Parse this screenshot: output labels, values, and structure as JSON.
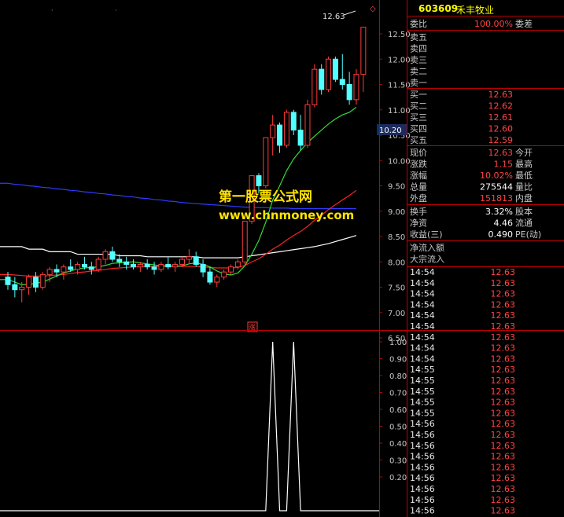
{
  "stock": {
    "code": "603609",
    "name": "禾丰牧业"
  },
  "watermark": {
    "line1": "第一股票公式网",
    "line2": "www.chnmoney.com"
  },
  "price_marker_top": "12.63",
  "price_marker_right": "10.20",
  "indicator_label": "涨",
  "quote": {
    "weibi_label": "委比",
    "weibi_value": "100.00%",
    "weicha_label": "委差",
    "sell_labels": [
      "卖五",
      "卖四",
      "卖三",
      "卖二",
      "卖一"
    ],
    "buy": [
      {
        "label": "买一",
        "price": "12.63"
      },
      {
        "label": "买二",
        "price": "12.62"
      },
      {
        "label": "买三",
        "price": "12.61"
      },
      {
        "label": "买四",
        "price": "12.60"
      },
      {
        "label": "买五",
        "price": "12.59"
      }
    ],
    "stats": [
      {
        "l1": "现价",
        "v1": "12.63",
        "l2": "今开",
        "c": "#ff4444"
      },
      {
        "l1": "涨跌",
        "v1": "1.15",
        "l2": "最高",
        "c": "#ff4444"
      },
      {
        "l1": "涨幅",
        "v1": "10.02%",
        "l2": "最低",
        "c": "#ff4444"
      },
      {
        "l1": "总量",
        "v1": "275544",
        "l2": "量比",
        "c": "#ffffff"
      },
      {
        "l1": "外盘",
        "v1": "151813",
        "l2": "内盘",
        "c": "#ff4444"
      }
    ],
    "stats2": [
      {
        "l1": "换手",
        "v1": "3.32%",
        "l2": "股本"
      },
      {
        "l1": "净资",
        "v1": "4.46",
        "l2": "流通"
      },
      {
        "l1": "收益(三)",
        "v1": "0.490",
        "l2": "PE(动)"
      }
    ],
    "flow_labels": [
      "净流入额",
      "大宗流入"
    ]
  },
  "ticks": [
    {
      "t": "14:54",
      "p": "12.63"
    },
    {
      "t": "14:54",
      "p": "12.63"
    },
    {
      "t": "14:54",
      "p": "12.63"
    },
    {
      "t": "14:54",
      "p": "12.63"
    },
    {
      "t": "14:54",
      "p": "12.63"
    },
    {
      "t": "14:54",
      "p": "12.63"
    },
    {
      "t": "14:54",
      "p": "12.63"
    },
    {
      "t": "14:54",
      "p": "12.63"
    },
    {
      "t": "14:54",
      "p": "12.63"
    },
    {
      "t": "14:55",
      "p": "12.63"
    },
    {
      "t": "14:55",
      "p": "12.63"
    },
    {
      "t": "14:55",
      "p": "12.63"
    },
    {
      "t": "14:55",
      "p": "12.63"
    },
    {
      "t": "14:55",
      "p": "12.63"
    },
    {
      "t": "14:56",
      "p": "12.63"
    },
    {
      "t": "14:56",
      "p": "12.63"
    },
    {
      "t": "14:56",
      "p": "12.63"
    },
    {
      "t": "14:56",
      "p": "12.63"
    },
    {
      "t": "14:56",
      "p": "12.63"
    },
    {
      "t": "14:56",
      "p": "12.63"
    },
    {
      "t": "14:56",
      "p": "12.63"
    },
    {
      "t": "14:56",
      "p": "12.63"
    },
    {
      "t": "14:56",
      "p": "12.63"
    }
  ],
  "chart_data": [
    {
      "type": "candlestick",
      "title": "",
      "ylim": [
        6.4,
        12.6
      ],
      "yticks": [
        "12.50",
        "12.00",
        "11.50",
        "11.00",
        "10.50",
        "10.00",
        "9.50",
        "9.00",
        "8.50",
        "8.00",
        "7.50",
        "7.00",
        "6.50"
      ],
      "candles": [
        {
          "o": 7.7,
          "h": 7.8,
          "l": 7.45,
          "c": 7.55
        },
        {
          "o": 7.55,
          "h": 7.7,
          "l": 7.3,
          "c": 7.45
        },
        {
          "o": 7.45,
          "h": 7.6,
          "l": 7.2,
          "c": 7.5
        },
        {
          "o": 7.5,
          "h": 7.75,
          "l": 7.35,
          "c": 7.7
        },
        {
          "o": 7.7,
          "h": 7.8,
          "l": 7.4,
          "c": 7.5
        },
        {
          "o": 7.5,
          "h": 7.8,
          "l": 7.45,
          "c": 7.75
        },
        {
          "o": 7.75,
          "h": 7.9,
          "l": 7.6,
          "c": 7.85
        },
        {
          "o": 7.85,
          "h": 7.95,
          "l": 7.7,
          "c": 7.8
        },
        {
          "o": 7.8,
          "h": 7.95,
          "l": 7.65,
          "c": 7.9
        },
        {
          "o": 7.9,
          "h": 8.05,
          "l": 7.8,
          "c": 7.85
        },
        {
          "o": 7.85,
          "h": 8.0,
          "l": 7.75,
          "c": 7.95
        },
        {
          "o": 7.95,
          "h": 8.1,
          "l": 7.85,
          "c": 7.9
        },
        {
          "o": 7.9,
          "h": 8.0,
          "l": 7.75,
          "c": 7.85
        },
        {
          "o": 7.85,
          "h": 8.1,
          "l": 7.8,
          "c": 8.05
        },
        {
          "o": 8.05,
          "h": 8.25,
          "l": 7.95,
          "c": 8.2
        },
        {
          "o": 8.2,
          "h": 8.3,
          "l": 8.0,
          "c": 8.05
        },
        {
          "o": 8.05,
          "h": 8.15,
          "l": 7.9,
          "c": 8.0
        },
        {
          "o": 8.0,
          "h": 8.1,
          "l": 7.85,
          "c": 7.95
        },
        {
          "o": 7.95,
          "h": 8.05,
          "l": 7.85,
          "c": 7.9
        },
        {
          "o": 7.9,
          "h": 8.0,
          "l": 7.8,
          "c": 7.95
        },
        {
          "o": 7.95,
          "h": 8.05,
          "l": 7.85,
          "c": 7.9
        },
        {
          "o": 7.9,
          "h": 8.0,
          "l": 7.75,
          "c": 7.85
        },
        {
          "o": 7.85,
          "h": 8.0,
          "l": 7.8,
          "c": 7.95
        },
        {
          "o": 7.95,
          "h": 8.1,
          "l": 7.85,
          "c": 7.9
        },
        {
          "o": 7.9,
          "h": 8.0,
          "l": 7.8,
          "c": 7.95
        },
        {
          "o": 7.95,
          "h": 8.1,
          "l": 7.9,
          "c": 8.05
        },
        {
          "o": 8.05,
          "h": 8.25,
          "l": 7.95,
          "c": 8.1
        },
        {
          "o": 8.1,
          "h": 8.2,
          "l": 7.9,
          "c": 7.95
        },
        {
          "o": 7.95,
          "h": 8.05,
          "l": 7.7,
          "c": 7.8
        },
        {
          "o": 7.8,
          "h": 7.9,
          "l": 7.55,
          "c": 7.6
        },
        {
          "o": 7.6,
          "h": 7.75,
          "l": 7.5,
          "c": 7.7
        },
        {
          "o": 7.7,
          "h": 7.85,
          "l": 7.65,
          "c": 7.8
        },
        {
          "o": 7.8,
          "h": 7.95,
          "l": 7.75,
          "c": 7.9
        },
        {
          "o": 7.9,
          "h": 8.05,
          "l": 7.85,
          "c": 8.0
        },
        {
          "o": 8.0,
          "h": 8.8,
          "l": 7.95,
          "c": 8.8
        },
        {
          "o": 8.8,
          "h": 9.7,
          "l": 8.75,
          "c": 9.7
        },
        {
          "o": 9.7,
          "h": 9.75,
          "l": 9.35,
          "c": 9.5
        },
        {
          "o": 9.5,
          "h": 10.45,
          "l": 9.45,
          "c": 10.45
        },
        {
          "o": 10.45,
          "h": 10.9,
          "l": 10.1,
          "c": 10.7
        },
        {
          "o": 10.7,
          "h": 10.75,
          "l": 10.15,
          "c": 10.3
        },
        {
          "o": 10.3,
          "h": 11.0,
          "l": 10.25,
          "c": 10.95
        },
        {
          "o": 10.95,
          "h": 11.0,
          "l": 10.5,
          "c": 10.6
        },
        {
          "o": 10.6,
          "h": 10.9,
          "l": 10.2,
          "c": 10.3
        },
        {
          "o": 10.3,
          "h": 11.2,
          "l": 10.25,
          "c": 11.1
        },
        {
          "o": 11.1,
          "h": 11.9,
          "l": 11.05,
          "c": 11.8
        },
        {
          "o": 11.8,
          "h": 11.9,
          "l": 11.3,
          "c": 11.4
        },
        {
          "o": 11.4,
          "h": 12.05,
          "l": 11.35,
          "c": 12.0
        },
        {
          "o": 12.0,
          "h": 12.05,
          "l": 11.55,
          "c": 11.6
        },
        {
          "o": 11.6,
          "h": 12.1,
          "l": 11.4,
          "c": 11.5
        },
        {
          "o": 11.5,
          "h": 11.75,
          "l": 11.1,
          "c": 11.2
        },
        {
          "o": 11.2,
          "h": 11.8,
          "l": 11.1,
          "c": 11.7
        },
        {
          "o": 11.7,
          "h": 12.6,
          "l": 11.35,
          "c": 12.63
        }
      ],
      "ma": [
        {
          "color": "#ffffff",
          "values": [
            8.3,
            8.3,
            8.3,
            8.25,
            8.25,
            8.25,
            8.2,
            8.2,
            8.2,
            8.2,
            8.15,
            8.15,
            8.15,
            8.15,
            8.15,
            8.15,
            8.12,
            8.12,
            8.12,
            8.12,
            8.1,
            8.1,
            8.1,
            8.1,
            8.1,
            8.1,
            8.1,
            8.1,
            8.08,
            8.08,
            8.08,
            8.08,
            8.08,
            8.08,
            8.1,
            8.12,
            8.14,
            8.16,
            8.18,
            8.2,
            8.22,
            8.24,
            8.26,
            8.28,
            8.3,
            8.33,
            8.36,
            8.4,
            8.44,
            8.48,
            8.52
          ]
        },
        {
          "color": "#2e3bff",
          "values": [
            9.55,
            9.53,
            9.52,
            9.5,
            9.49,
            9.47,
            9.46,
            9.44,
            9.43,
            9.41,
            9.4,
            9.38,
            9.37,
            9.35,
            9.34,
            9.32,
            9.31,
            9.29,
            9.28,
            9.26,
            9.25,
            9.23,
            9.22,
            9.2,
            9.19,
            9.17,
            9.16,
            9.15,
            9.14,
            9.13,
            9.12,
            9.11,
            9.1,
            9.09,
            9.08,
            9.08,
            9.07,
            9.07,
            9.06,
            9.06,
            9.06,
            9.05,
            9.05,
            9.05,
            9.05,
            9.05,
            9.05,
            9.05,
            9.05,
            9.05,
            9.05
          ]
        },
        {
          "color": "#ff2222",
          "values": [
            7.75,
            7.74,
            7.73,
            7.72,
            7.72,
            7.72,
            7.73,
            7.74,
            7.75,
            7.77,
            7.79,
            7.8,
            7.82,
            7.83,
            7.85,
            7.87,
            7.88,
            7.89,
            7.9,
            7.9,
            7.91,
            7.91,
            7.91,
            7.91,
            7.91,
            7.91,
            7.91,
            7.91,
            7.9,
            7.89,
            7.88,
            7.88,
            7.88,
            7.89,
            7.93,
            8.0,
            8.06,
            8.15,
            8.25,
            8.33,
            8.43,
            8.52,
            8.6,
            8.7,
            8.82,
            8.92,
            9.03,
            9.13,
            9.22,
            9.31,
            9.41
          ]
        },
        {
          "color": "#33dd33",
          "values": [
            7.65,
            7.6,
            7.55,
            7.55,
            7.58,
            7.6,
            7.66,
            7.72,
            7.78,
            7.82,
            7.86,
            7.88,
            7.89,
            7.9,
            7.93,
            7.97,
            7.98,
            7.99,
            8.0,
            7.98,
            7.96,
            7.94,
            7.92,
            7.92,
            7.91,
            7.92,
            7.96,
            7.98,
            7.95,
            7.9,
            7.82,
            7.76,
            7.74,
            7.78,
            7.92,
            8.15,
            8.42,
            8.78,
            9.22,
            9.5,
            9.8,
            10.03,
            10.2,
            10.35,
            10.48,
            10.6,
            10.72,
            10.82,
            10.9,
            10.95,
            11.05
          ]
        }
      ]
    },
    {
      "type": "line",
      "title": "",
      "ylim": [
        0,
        1.05
      ],
      "yticks": [
        "1.00",
        "0.90",
        "0.80",
        "0.70",
        "0.60",
        "0.50",
        "0.40",
        "0.30",
        "0.20"
      ],
      "values": [
        0,
        0,
        0,
        0,
        0,
        0,
        0,
        0,
        0,
        0,
        0,
        0,
        0,
        0,
        0,
        0,
        0,
        0,
        0,
        0,
        0,
        0,
        0,
        0,
        0,
        0,
        0,
        0,
        0,
        0,
        0,
        0,
        0,
        0,
        0,
        0,
        0,
        0,
        1,
        0,
        0,
        1,
        0,
        0,
        0,
        0,
        0,
        0,
        0,
        0,
        0
      ]
    }
  ]
}
